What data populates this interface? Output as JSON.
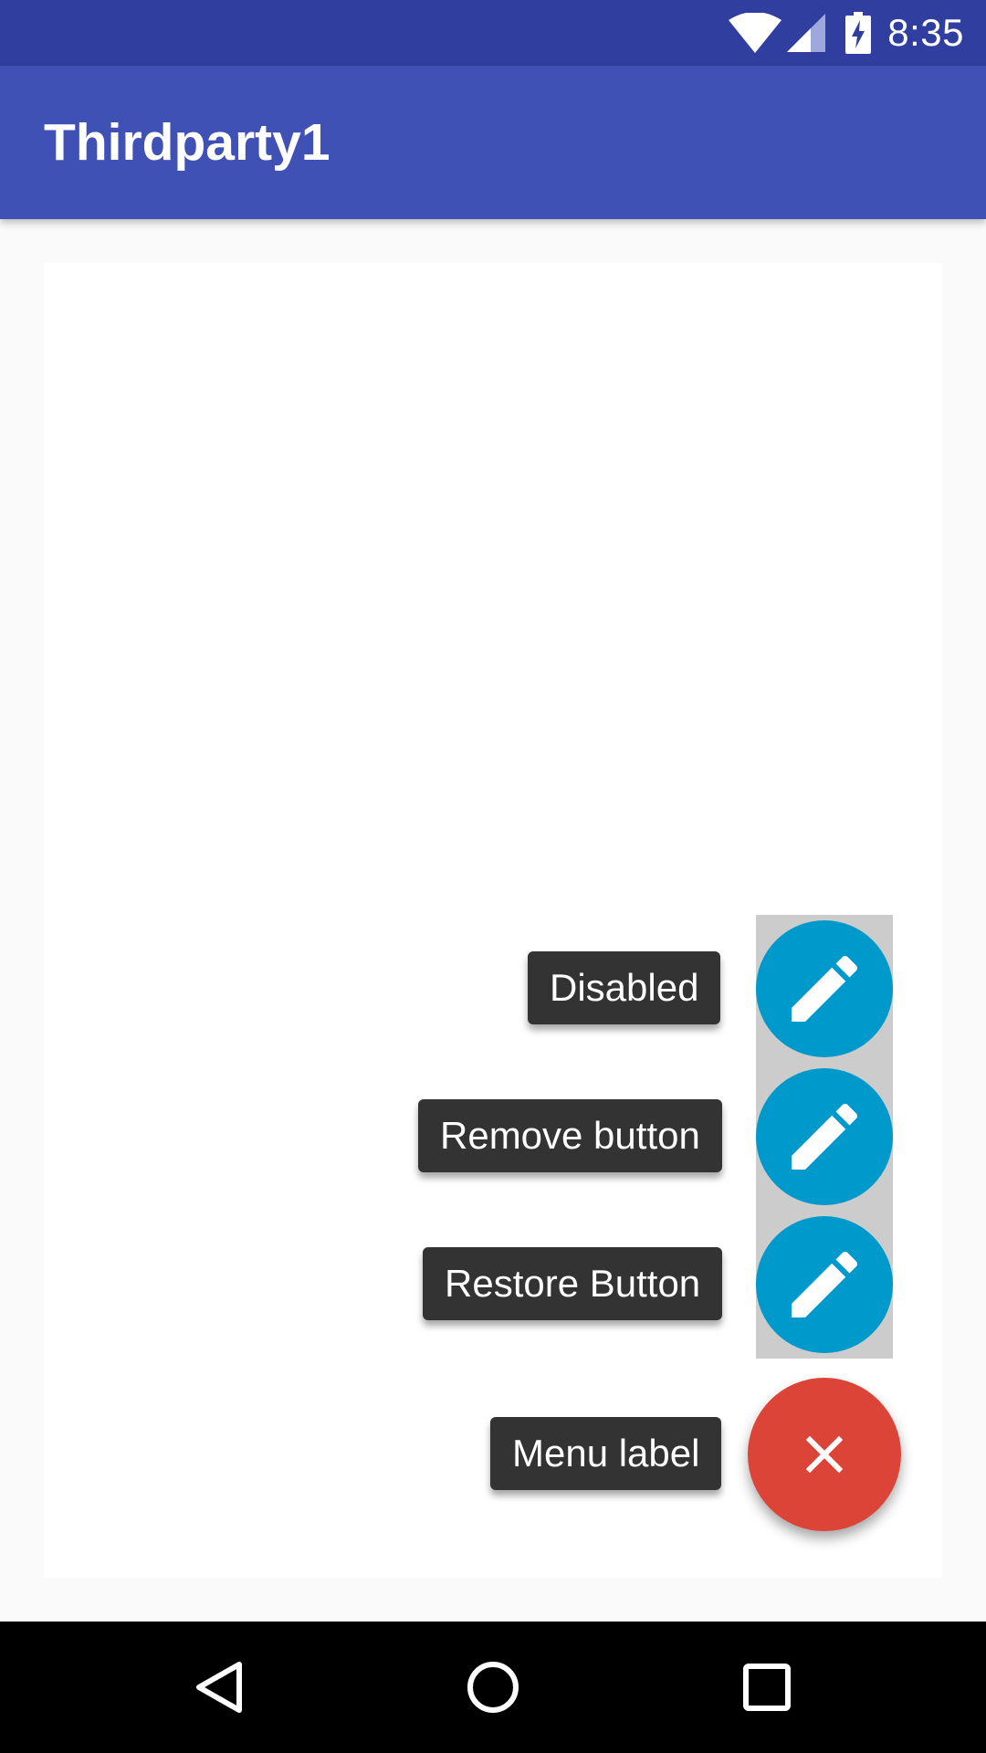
{
  "status_bar": {
    "time": "8:35",
    "icons": [
      "wifi-icon",
      "signal-icon",
      "battery-charging-icon"
    ]
  },
  "app_bar": {
    "title": "Thirdparty1"
  },
  "fab_menu": {
    "items": [
      {
        "label": "Disabled",
        "icon": "pencil-icon"
      },
      {
        "label": "Remove button",
        "icon": "pencil-icon"
      },
      {
        "label": "Restore Button",
        "icon": "pencil-icon"
      }
    ],
    "menu_label": "Menu label",
    "main_icon": "close-icon"
  },
  "nav_bar": {
    "icons": [
      "back-icon",
      "home-icon",
      "recents-icon"
    ]
  },
  "colors": {
    "status_bar": "#303f9f",
    "app_bar": "#3f51b5",
    "mini_fab": "#0099cc",
    "main_fab": "#db4437",
    "label_bg": "#333333"
  }
}
